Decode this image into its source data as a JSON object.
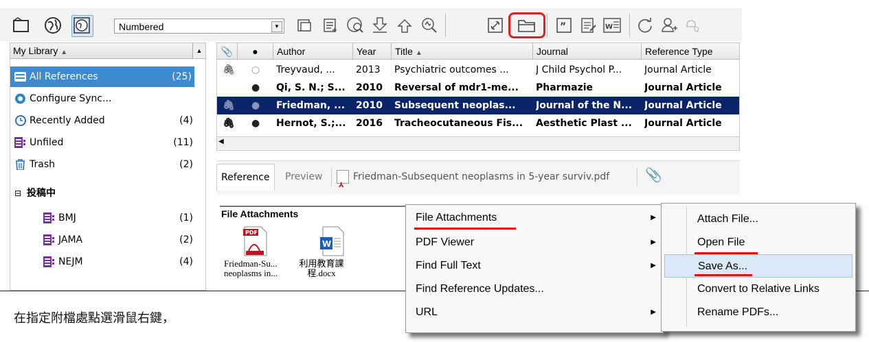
{
  "toolbar": {
    "style_select": "Numbered",
    "icons": [
      "new-library",
      "online-search",
      "integrated-library",
      "sync",
      "insert-citation",
      "format-bibliography",
      "find-full-text",
      "download",
      "upload",
      "search-online",
      "link",
      "open-file",
      "quote",
      "annotate",
      "word-doc",
      "refresh",
      "share-user",
      "find"
    ]
  },
  "library": {
    "header": "My Library",
    "items": [
      {
        "label": "All References",
        "count": "(25)",
        "icon": "all-references-icon",
        "selected": true
      },
      {
        "label": "Configure Sync...",
        "count": "",
        "icon": "sync-icon"
      },
      {
        "label": "Recently Added",
        "count": "(4)",
        "icon": "clock-icon"
      },
      {
        "label": "Unfiled",
        "count": "(11)",
        "icon": "unfiled-icon"
      },
      {
        "label": "Trash",
        "count": "(2)",
        "icon": "trash-icon"
      }
    ],
    "group_title": "投稿中",
    "group_items": [
      {
        "label": "BMJ",
        "count": "(1)"
      },
      {
        "label": "JAMA",
        "count": "(2)"
      },
      {
        "label": "NEJM",
        "count": "(4)"
      }
    ]
  },
  "references": {
    "columns": [
      "Author",
      "Year",
      "Title",
      "Journal",
      "Reference Type"
    ],
    "rows": [
      {
        "author": "Treyvaud, ...",
        "year": "2013",
        "title": "Psychiatric outcomes ...",
        "journal": "J Child Psychol P...",
        "type": "Journal Article",
        "bold": false,
        "selected": false,
        "clip": true,
        "read": false
      },
      {
        "author": "Qi, S. N.; S...",
        "year": "2010",
        "title": "Reversal of mdr1-me...",
        "journal": "Pharmazie",
        "type": "Journal Article",
        "bold": true,
        "selected": false,
        "clip": false,
        "read": true
      },
      {
        "author": "Friedman, ...",
        "year": "2010",
        "title": "Subsequent neoplas...",
        "journal": "Journal of the N...",
        "type": "Journal Article",
        "bold": true,
        "selected": true,
        "clip": true,
        "read": true
      },
      {
        "author": "Hernot, S.;...",
        "year": "2016",
        "title": "Tracheocutaneous Fis...",
        "journal": "Aesthetic Plast ...",
        "type": "Journal Article",
        "bold": true,
        "selected": false,
        "clip": true,
        "read": true
      }
    ]
  },
  "tabs": {
    "reference": "Reference",
    "preview": "Preview",
    "pdf": "Friedman-Subsequent neoplasms in 5-year surviv.pdf"
  },
  "attachments": {
    "title": "File Attachments",
    "files": [
      {
        "line1": "Friedman-Su...",
        "line2": "neoplasms in...",
        "kind": "pdf"
      },
      {
        "line1": "利用教育課",
        "line2": "程.docx",
        "kind": "word"
      }
    ]
  },
  "context_menu": {
    "items": [
      "File Attachments",
      "PDF Viewer",
      "Find Full Text",
      "Find Reference Updates...",
      "URL"
    ],
    "has_submenu": [
      true,
      true,
      true,
      false,
      true
    ]
  },
  "submenu": {
    "items": [
      "Attach File...",
      "Open File",
      "Save As...",
      "Convert to Relative Links",
      "Rename PDFs..."
    ]
  },
  "caption": "在指定附檔處點選滑鼠右鍵，",
  "colors": {
    "selection": "#0a246a",
    "highlight": "#e02020",
    "menu_hover": "#dbe8f7"
  }
}
